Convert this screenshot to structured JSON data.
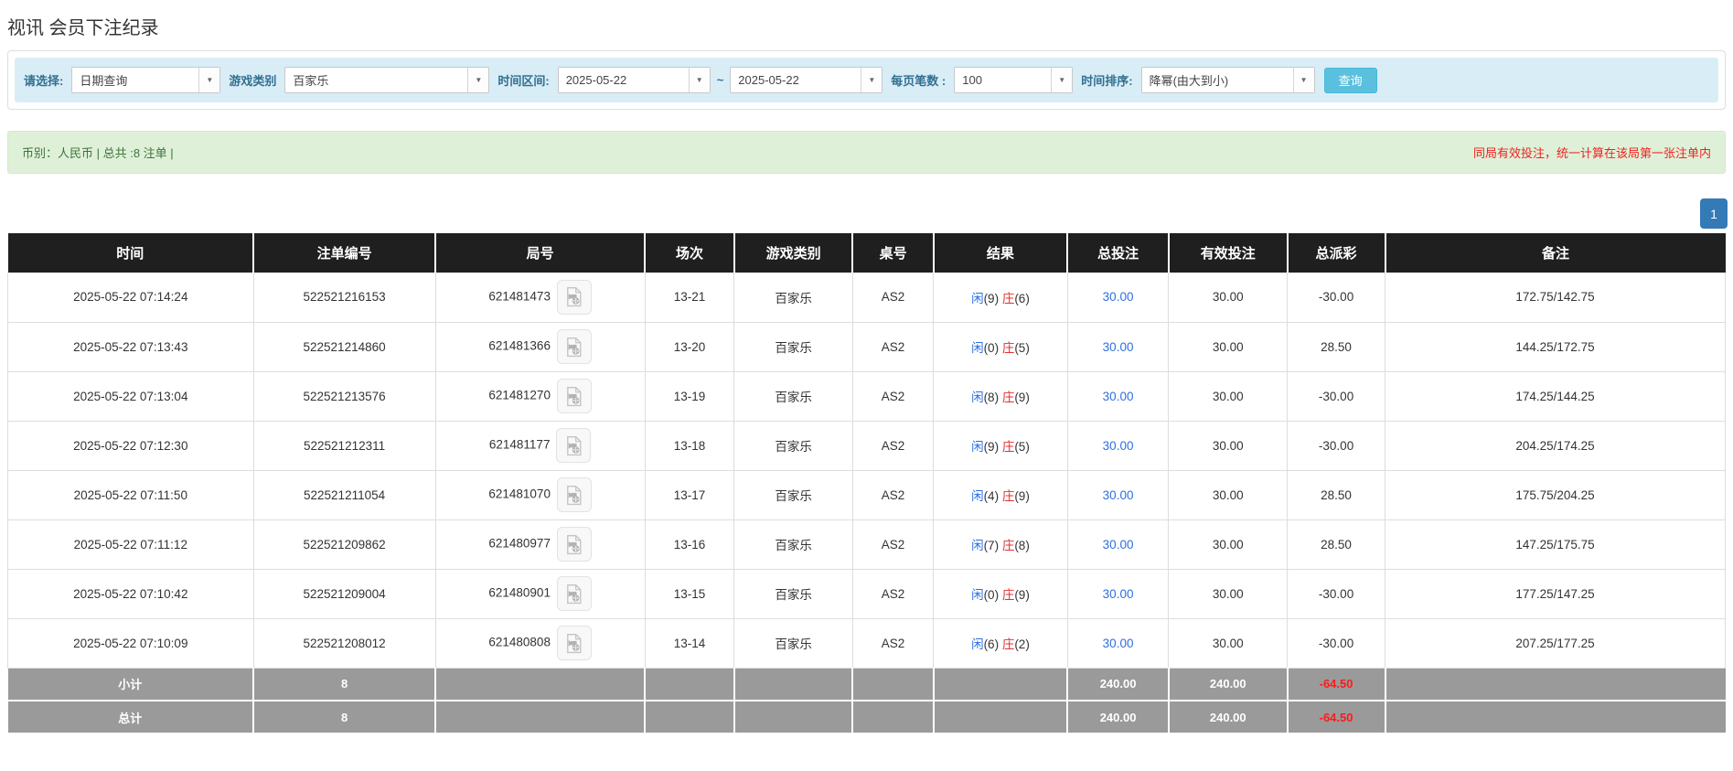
{
  "page_title": "视讯 会员下注纪录",
  "filters": {
    "query_type": {
      "label": "请选择:",
      "value": "日期查询"
    },
    "game_type": {
      "label": "游戏类别",
      "value": "百家乐"
    },
    "time_range": {
      "label": "时间区间:",
      "from": "2025-05-22",
      "separator": "~",
      "to": "2025-05-22"
    },
    "page_size": {
      "label": "每页笔数 :",
      "value": "100"
    },
    "sort": {
      "label": "时间排序:",
      "value": "降幂(由大到小)"
    },
    "search_button_label": "查询",
    "caret_glyph": "▼"
  },
  "summary_bar": {
    "left": "币别：人民币 | 总共 :8 注单 |",
    "notice": "同局有效投注，统一计算在该局第一张注单内"
  },
  "pagination": {
    "current_page": "1"
  },
  "result_labels": {
    "player": "闲",
    "banker": "庄"
  },
  "table": {
    "columns": [
      {
        "key": "time",
        "label": "时间"
      },
      {
        "key": "bet-no",
        "label": "注单编号"
      },
      {
        "key": "round-no",
        "label": "局号"
      },
      {
        "key": "session",
        "label": "场次"
      },
      {
        "key": "game-type",
        "label": "游戏类别"
      },
      {
        "key": "table-no",
        "label": "桌号"
      },
      {
        "key": "result",
        "label": "结果"
      },
      {
        "key": "total-bet",
        "label": "总投注"
      },
      {
        "key": "valid-bet",
        "label": "有效投注"
      },
      {
        "key": "total-payout",
        "label": "总派彩"
      },
      {
        "key": "note",
        "label": "备注"
      }
    ],
    "rows": [
      {
        "time": "2025-05-22 07:14:24",
        "bet_no": "522521216153",
        "round_no": "621481473",
        "session": "13-21",
        "game": "百家乐",
        "table_no": "AS2",
        "player": "9",
        "banker": "6",
        "total_bet": "30.00",
        "valid_bet": "30.00",
        "payout": "-30.00",
        "note": "172.75/142.75"
      },
      {
        "time": "2025-05-22 07:13:43",
        "bet_no": "522521214860",
        "round_no": "621481366",
        "session": "13-20",
        "game": "百家乐",
        "table_no": "AS2",
        "player": "0",
        "banker": "5",
        "total_bet": "30.00",
        "valid_bet": "30.00",
        "payout": "28.50",
        "note": "144.25/172.75"
      },
      {
        "time": "2025-05-22 07:13:04",
        "bet_no": "522521213576",
        "round_no": "621481270",
        "session": "13-19",
        "game": "百家乐",
        "table_no": "AS2",
        "player": "8",
        "banker": "9",
        "total_bet": "30.00",
        "valid_bet": "30.00",
        "payout": "-30.00",
        "note": "174.25/144.25"
      },
      {
        "time": "2025-05-22 07:12:30",
        "bet_no": "522521212311",
        "round_no": "621481177",
        "session": "13-18",
        "game": "百家乐",
        "table_no": "AS2",
        "player": "9",
        "banker": "5",
        "total_bet": "30.00",
        "valid_bet": "30.00",
        "payout": "-30.00",
        "note": "204.25/174.25"
      },
      {
        "time": "2025-05-22 07:11:50",
        "bet_no": "522521211054",
        "round_no": "621481070",
        "session": "13-17",
        "game": "百家乐",
        "table_no": "AS2",
        "player": "4",
        "banker": "9",
        "total_bet": "30.00",
        "valid_bet": "30.00",
        "payout": "28.50",
        "note": "175.75/204.25"
      },
      {
        "time": "2025-05-22 07:11:12",
        "bet_no": "522521209862",
        "round_no": "621480977",
        "session": "13-16",
        "game": "百家乐",
        "table_no": "AS2",
        "player": "7",
        "banker": "8",
        "total_bet": "30.00",
        "valid_bet": "30.00",
        "payout": "28.50",
        "note": "147.25/175.75"
      },
      {
        "time": "2025-05-22 07:10:42",
        "bet_no": "522521209004",
        "round_no": "621480901",
        "session": "13-15",
        "game": "百家乐",
        "table_no": "AS2",
        "player": "0",
        "banker": "9",
        "total_bet": "30.00",
        "valid_bet": "30.00",
        "payout": "-30.00",
        "note": "177.25/147.25"
      },
      {
        "time": "2025-05-22 07:10:09",
        "bet_no": "522521208012",
        "round_no": "621480808",
        "session": "13-14",
        "game": "百家乐",
        "table_no": "AS2",
        "player": "6",
        "banker": "2",
        "total_bet": "30.00",
        "valid_bet": "30.00",
        "payout": "-30.00",
        "note": "207.25/177.25"
      }
    ],
    "subtotal": {
      "label": "小计",
      "count": "8",
      "total_bet": "240.00",
      "valid_bet": "240.00",
      "payout": "-64.50"
    },
    "grand_total": {
      "label": "总计",
      "count": "8",
      "total_bet": "240.00",
      "valid_bet": "240.00",
      "payout": "-64.50"
    }
  },
  "colors": {
    "header_bg": "#1f1f1f",
    "summary_gray": "#9a9a9a",
    "link_blue": "#2e6fe0",
    "banker_red": "#e03030",
    "loss_red": "#f50000",
    "filter_bar_bg": "#d9edf7",
    "alert_bg": "#dff0d8",
    "search_button_bg": "#5bc0de",
    "pagination_blue": "#337ab7"
  }
}
